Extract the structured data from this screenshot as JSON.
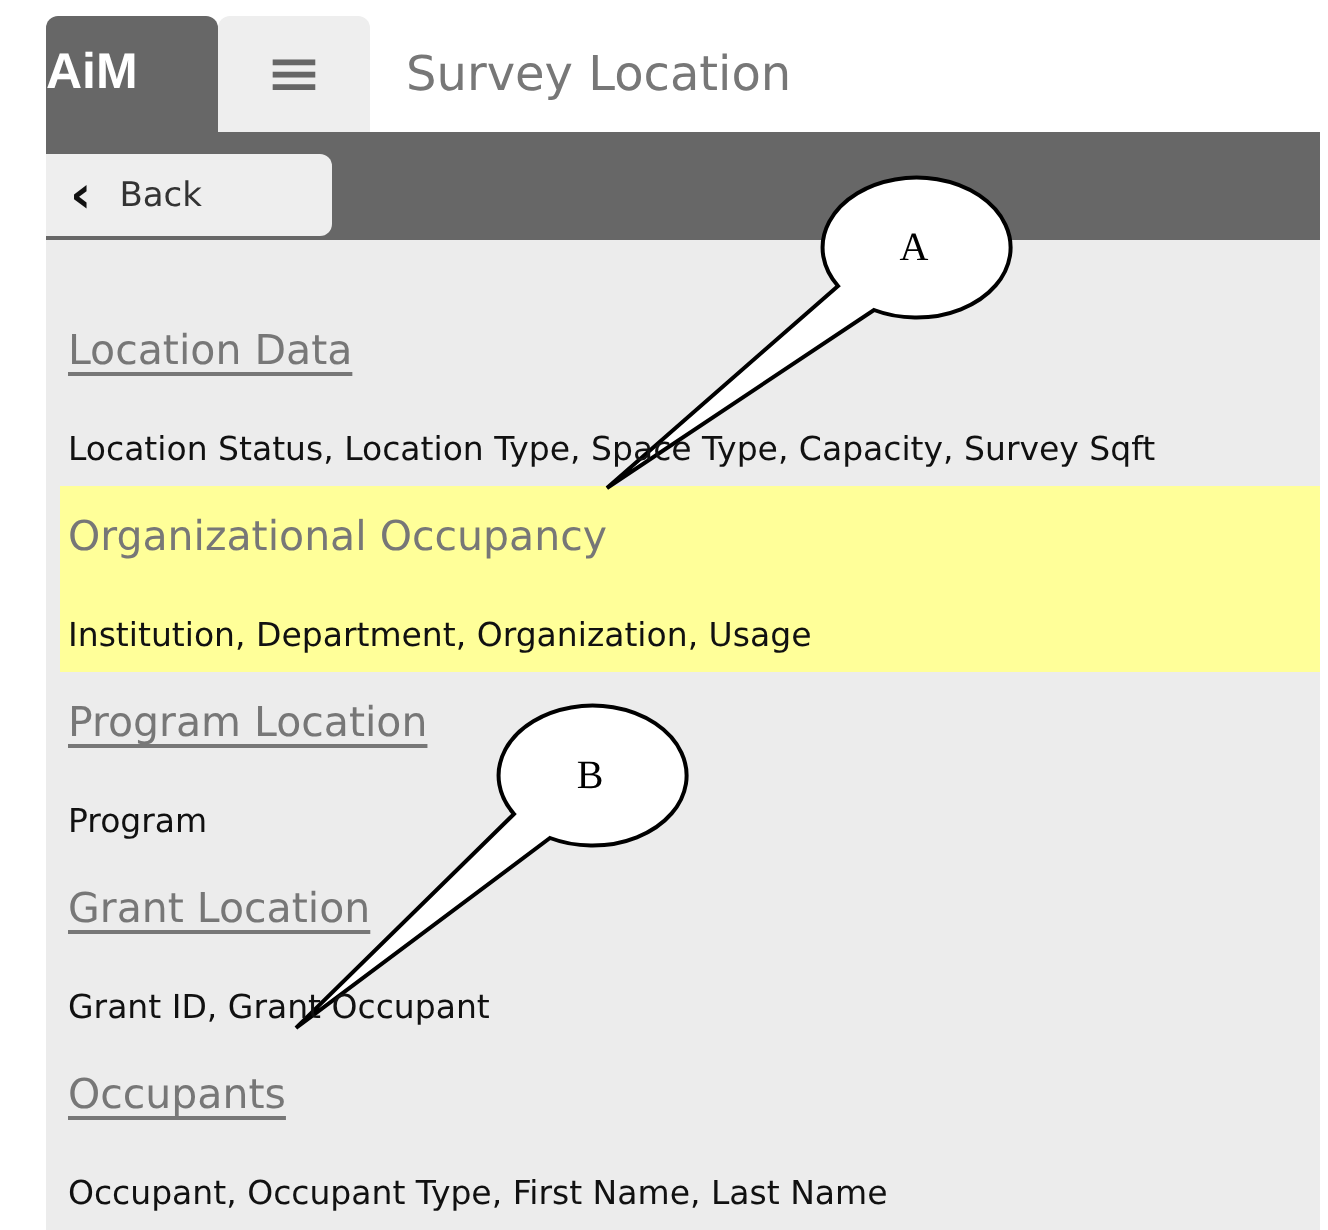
{
  "header": {
    "logo": "AiM",
    "menu_icon": "≡",
    "title": "Survey Location"
  },
  "toolbar": {
    "back_button": {
      "icon": "‹",
      "label": "Back"
    }
  },
  "sections": [
    {
      "title": "Location Data",
      "fields": "Location Status, Location Type, Space Type, Capacity, Survey Sqft",
      "selected": false
    },
    {
      "title": "Organizational Occupancy",
      "fields": "Institution, Department, Organization, Usage",
      "selected": true
    },
    {
      "title": "Program Location",
      "fields": "Program",
      "selected": false
    },
    {
      "title": "Grant Location",
      "fields": "Grant ID, Grant Occupant",
      "selected": false
    },
    {
      "title": "Occupants",
      "fields": "Occupant, Occupant Type, First Name, Last Name",
      "selected": false
    }
  ],
  "callouts": [
    {
      "label": "A"
    },
    {
      "label": "B"
    }
  ]
}
